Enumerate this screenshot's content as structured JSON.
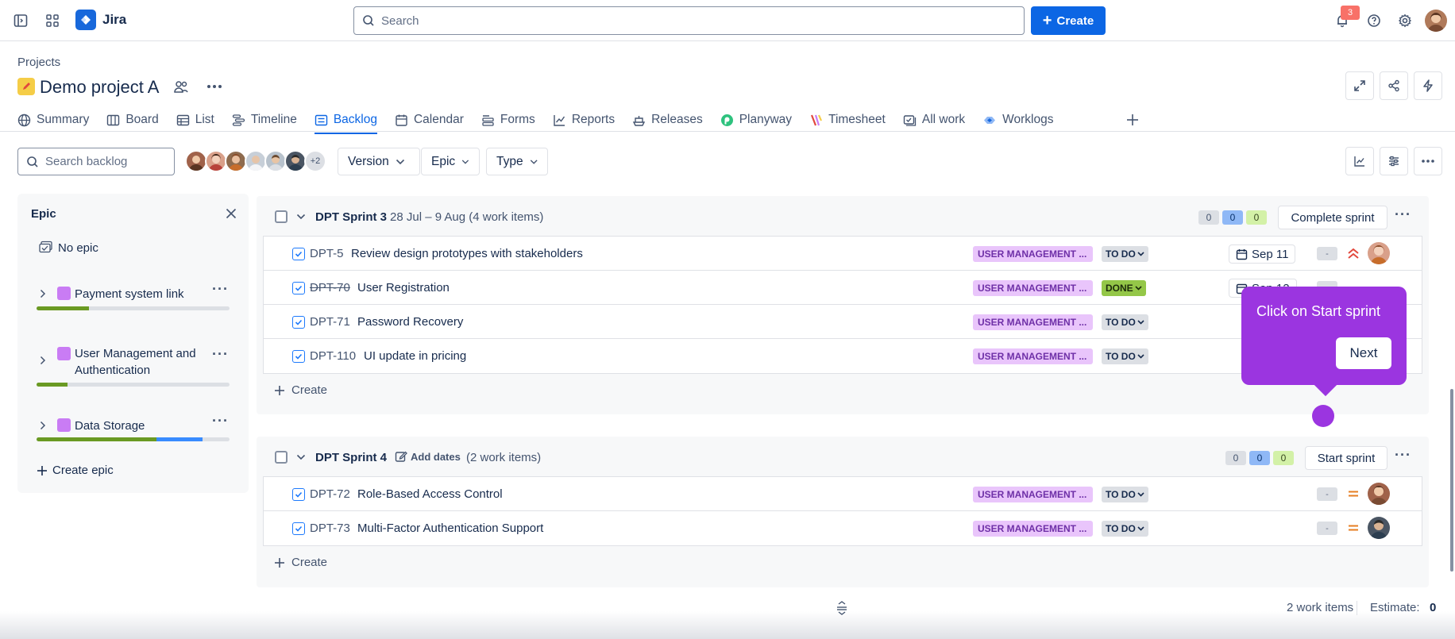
{
  "topbar": {
    "app_name": "Jira",
    "search_placeholder": "Search",
    "create_label": "Create",
    "notifications_count": "3"
  },
  "header": {
    "breadcrumb": "Projects",
    "project_name": "Demo project A"
  },
  "tabs": [
    {
      "label": "Summary"
    },
    {
      "label": "Board"
    },
    {
      "label": "List"
    },
    {
      "label": "Timeline"
    },
    {
      "label": "Backlog"
    },
    {
      "label": "Calendar"
    },
    {
      "label": "Forms"
    },
    {
      "label": "Reports"
    },
    {
      "label": "Releases"
    },
    {
      "label": "Planyway"
    },
    {
      "label": "Timesheet"
    },
    {
      "label": "All work"
    },
    {
      "label": "Worklogs"
    }
  ],
  "filters": {
    "search_placeholder": "Search backlog",
    "more_avatars": "+2",
    "version": "Version",
    "epic": "Epic",
    "type": "Type"
  },
  "epic_panel": {
    "title": "Epic",
    "no_epic": "No epic",
    "epics": [
      {
        "name": "Payment system link",
        "done": 0.27,
        "in_progress": 0
      },
      {
        "name": "User Management and Authentication",
        "done": 0.16,
        "in_progress": 0
      },
      {
        "name": "Data Storage",
        "done": 0.62,
        "in_progress": 0.24
      }
    ],
    "create_epic": "Create epic"
  },
  "sprints": [
    {
      "name": "DPT Sprint 3",
      "meta": "28 Jul – 9 Aug (4 work items)",
      "counts": [
        "0",
        "0",
        "0"
      ],
      "action": "Complete sprint",
      "items": [
        {
          "key": "DPT-5",
          "summary": "Review design prototypes with stakeholders",
          "epic": "USER MANAGEMENT ...",
          "status": "TO DO",
          "date": "Sep 11",
          "estimate": "-"
        },
        {
          "key": "DPT-70",
          "summary": "User Registration",
          "epic": "USER MANAGEMENT ...",
          "status": "DONE",
          "date": "Sep 12",
          "estimate": "-"
        },
        {
          "key": "DPT-71",
          "summary": "Password Recovery",
          "epic": "USER MANAGEMENT ...",
          "status": "TO DO",
          "date": "",
          "estimate": "-"
        },
        {
          "key": "DPT-110",
          "summary": "UI update in pricing",
          "epic": "USER MANAGEMENT ...",
          "status": "TO DO",
          "date": "",
          "estimate": "-"
        }
      ],
      "create": "Create"
    },
    {
      "name": "DPT Sprint 4",
      "add_dates": "Add dates",
      "meta": "(2 work items)",
      "counts": [
        "0",
        "0",
        "0"
      ],
      "action": "Start sprint",
      "items": [
        {
          "key": "DPT-72",
          "summary": "Role-Based Access Control",
          "epic": "USER MANAGEMENT ...",
          "status": "TO DO",
          "estimate": "-"
        },
        {
          "key": "DPT-73",
          "summary": "Multi-Factor Authentication Support",
          "epic": "USER MANAGEMENT ...",
          "status": "TO DO",
          "estimate": "-"
        }
      ],
      "create": "Create"
    }
  ],
  "tooltip": {
    "text": "Click on Start sprint",
    "next": "Next"
  },
  "footer": {
    "work_items": "2 work items",
    "estimate_label": "Estimate:",
    "estimate_value": "0"
  },
  "colors": {
    "primary": "#0c66e4",
    "tooltip": "#9b35e0",
    "epic": "#c97cf4",
    "done_bar": "#6a9a23",
    "progress_bar": "#388bff"
  }
}
